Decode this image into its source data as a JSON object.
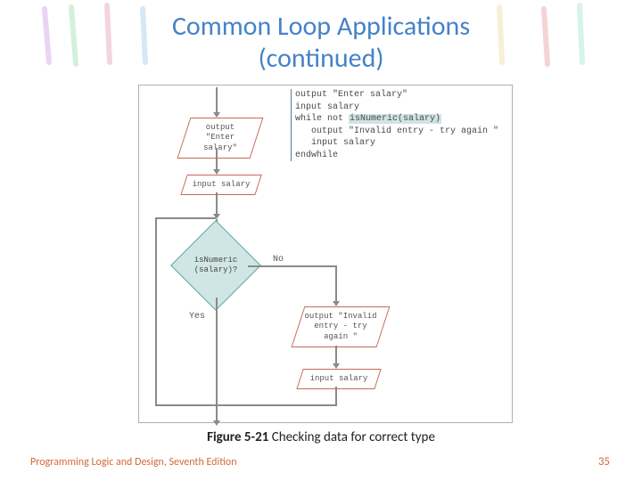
{
  "title_line1": "Common Loop Applications",
  "title_line2": "(continued)",
  "flowchart": {
    "box_output_enter": "output \"Enter\nsalary\"",
    "box_input_salary": "input salary",
    "decision_text": "isNumeric\n(salary)?",
    "branch_no": "No",
    "branch_yes": "Yes",
    "box_output_invalid": "output \"Invalid\nentry - try\nagain \"",
    "box_input_salary2": "input salary"
  },
  "pseudocode": {
    "l1": "output \"Enter salary\"",
    "l2": "input salary",
    "l3a": "while not ",
    "l3b": "isNumeric(salary)",
    "l4": "output \"Invalid entry - try again \"",
    "l5": "input salary",
    "l6": "endwhile"
  },
  "caption_bold": "Figure 5-21",
  "caption_rest": " Checking data for correct type",
  "footer_left": "Programming Logic and Design, Seventh Edition",
  "page_number": "35"
}
